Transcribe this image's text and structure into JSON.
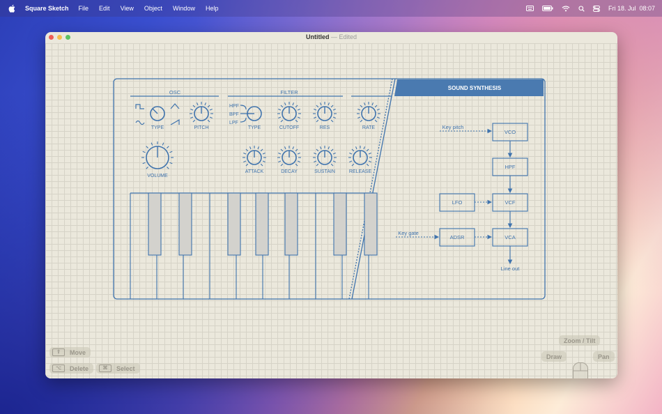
{
  "menubar": {
    "app_name": "Square Sketch",
    "menus": [
      "File",
      "Edit",
      "View",
      "Object",
      "Window",
      "Help"
    ],
    "datetime": "Fri 18. Jul  08:07"
  },
  "window": {
    "title": "Untitled",
    "status": "Edited"
  },
  "synth": {
    "sections": {
      "osc": "OSC",
      "filter": "FILTER"
    },
    "osc_knobs": {
      "type": "TYPE",
      "pitch": "PITCH",
      "volume": "VOLUME"
    },
    "filter_modes": [
      "HPF",
      "BPF",
      "LPF"
    ],
    "filter_knobs": {
      "type": "TYPE",
      "cutoff": "CUTOFF",
      "res": "RES",
      "rate": "RATE"
    },
    "env_knobs": {
      "attack": "ATTACK",
      "decay": "DECAY",
      "sustain": "SUSTAIN",
      "release": "RELEASE"
    },
    "panel_title": "SOUND SYNTHESIS",
    "blocks": {
      "vco": "VCO",
      "hpf": "HPF",
      "vcf": "VCF",
      "vca": "VCA",
      "lfo": "LFO",
      "adsr": "ADSR"
    },
    "labels": {
      "key_pitch": "Key pitch",
      "key_gate": "Key gate",
      "line_out": "Line out"
    }
  },
  "hints": {
    "move": "Move",
    "delete": "Delete",
    "select": "Select",
    "zoom": "Zoom / Tilt",
    "draw": "Draw",
    "pan": "Pan"
  },
  "colors": {
    "ink": "#3f73ad",
    "panel_header": "#4a7ab0",
    "canvas": "#ebe8dc"
  }
}
